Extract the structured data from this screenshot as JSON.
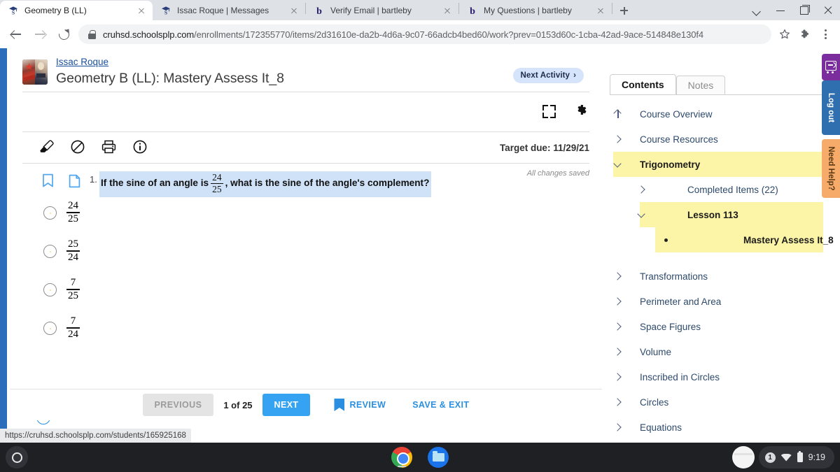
{
  "browser": {
    "tabs": [
      {
        "title": "Geometry B (LL)",
        "favicon": "schoology-cap-icon",
        "active": true
      },
      {
        "title": "Issac Roque | Messages",
        "favicon": "schoology-cap-icon",
        "active": false
      },
      {
        "title": "Verify Email | bartleby",
        "favicon": "bartleby-b-icon",
        "active": false
      },
      {
        "title": "My Questions | bartleby",
        "favicon": "bartleby-b-icon",
        "active": false
      }
    ],
    "new_tab_label": "+",
    "url_domain": "cruhsd.schoolsplp.com",
    "url_path": "/enrollments/172355770/items/2d31610e-da2b-4d6a-9c07-66adcb4bed60/work?prev=0153d60c-1cba-42ad-9ace-514848e130f4",
    "status_link": "https://cruhsd.schoolsplp.com/students/165925168"
  },
  "course": {
    "student_name": "Issac Roque",
    "title": "Geometry B (LL): Mastery Assess It_8",
    "next_activity_label": "Next Activity",
    "next_activity_chevron": "›",
    "target_due": "Target due: 11/29/21",
    "saved_note": "All changes saved"
  },
  "question": {
    "number": "1.",
    "text_before": "If the sine of an angle is",
    "fraction": {
      "numerator": "24",
      "denominator": "25"
    },
    "text_after": ", what is the sine of the angle's complement?",
    "choices": [
      {
        "numerator": "24",
        "denominator": "25",
        "selected": false
      },
      {
        "numerator": "25",
        "denominator": "24",
        "selected": false
      },
      {
        "numerator": "7",
        "denominator": "25",
        "selected": false
      },
      {
        "numerator": "7",
        "denominator": "24",
        "selected": false
      }
    ]
  },
  "bottom_nav": {
    "previous": "PREVIOUS",
    "page_count": "1 of 25",
    "next": "NEXT",
    "review": "REVIEW",
    "save_exit": "SAVE & EXIT"
  },
  "panel": {
    "tabs": [
      {
        "label": "Contents",
        "active": true
      },
      {
        "label": "Notes",
        "active": false
      }
    ],
    "items": [
      {
        "label": "Course Overview",
        "icon": "up-arrow-icon",
        "indent": 0,
        "highlight": false,
        "bold": false
      },
      {
        "label": "Course Resources",
        "icon": "chevron-right-icon",
        "indent": 0,
        "highlight": false,
        "bold": false
      },
      {
        "label": "Trigonometry",
        "icon": "chevron-down-icon",
        "indent": 0,
        "highlight": true,
        "bold": true
      },
      {
        "label": "Completed Items (22)",
        "icon": "chevron-right-icon",
        "indent": 1,
        "highlight": false,
        "bold": false
      },
      {
        "label": "Lesson 113",
        "icon": "chevron-down-icon",
        "indent": 1,
        "highlight": true,
        "bold": true
      },
      {
        "label": "Mastery Assess It_8",
        "icon": "bullet-icon",
        "indent": 2,
        "highlight": true,
        "bold": true
      },
      {
        "label": "Transformations",
        "icon": "chevron-right-icon",
        "indent": 0,
        "highlight": false,
        "bold": false
      },
      {
        "label": "Perimeter and Area",
        "icon": "chevron-right-icon",
        "indent": 0,
        "highlight": false,
        "bold": false
      },
      {
        "label": "Space Figures",
        "icon": "chevron-right-icon",
        "indent": 0,
        "highlight": false,
        "bold": false
      },
      {
        "label": "Volume",
        "icon": "chevron-right-icon",
        "indent": 0,
        "highlight": false,
        "bold": false
      },
      {
        "label": "Inscribed in Circles",
        "icon": "chevron-right-icon",
        "indent": 0,
        "highlight": false,
        "bold": false
      },
      {
        "label": "Circles",
        "icon": "chevron-right-icon",
        "indent": 0,
        "highlight": false,
        "bold": false
      },
      {
        "label": "Equations",
        "icon": "chevron-right-icon",
        "indent": 0,
        "highlight": false,
        "bold": false
      }
    ]
  },
  "side_widgets": {
    "cart_icon": "cart-icon",
    "logout": "Log out",
    "help": "Need Help?"
  },
  "shelf": {
    "apps": [
      "chrome-icon",
      "files-icon"
    ],
    "notification_count": "1",
    "time": "9:19"
  },
  "colors": {
    "accent_blue": "#35a3f2",
    "link_blue": "#2a8fe0",
    "highlight_yellow": "#fcf5a8",
    "selection_blue": "#cfe2f7",
    "left_strip": "#2a6ebb",
    "logout": "#2f6fb0",
    "help": "#f6ab6a",
    "cart": "#7b2d9e"
  }
}
